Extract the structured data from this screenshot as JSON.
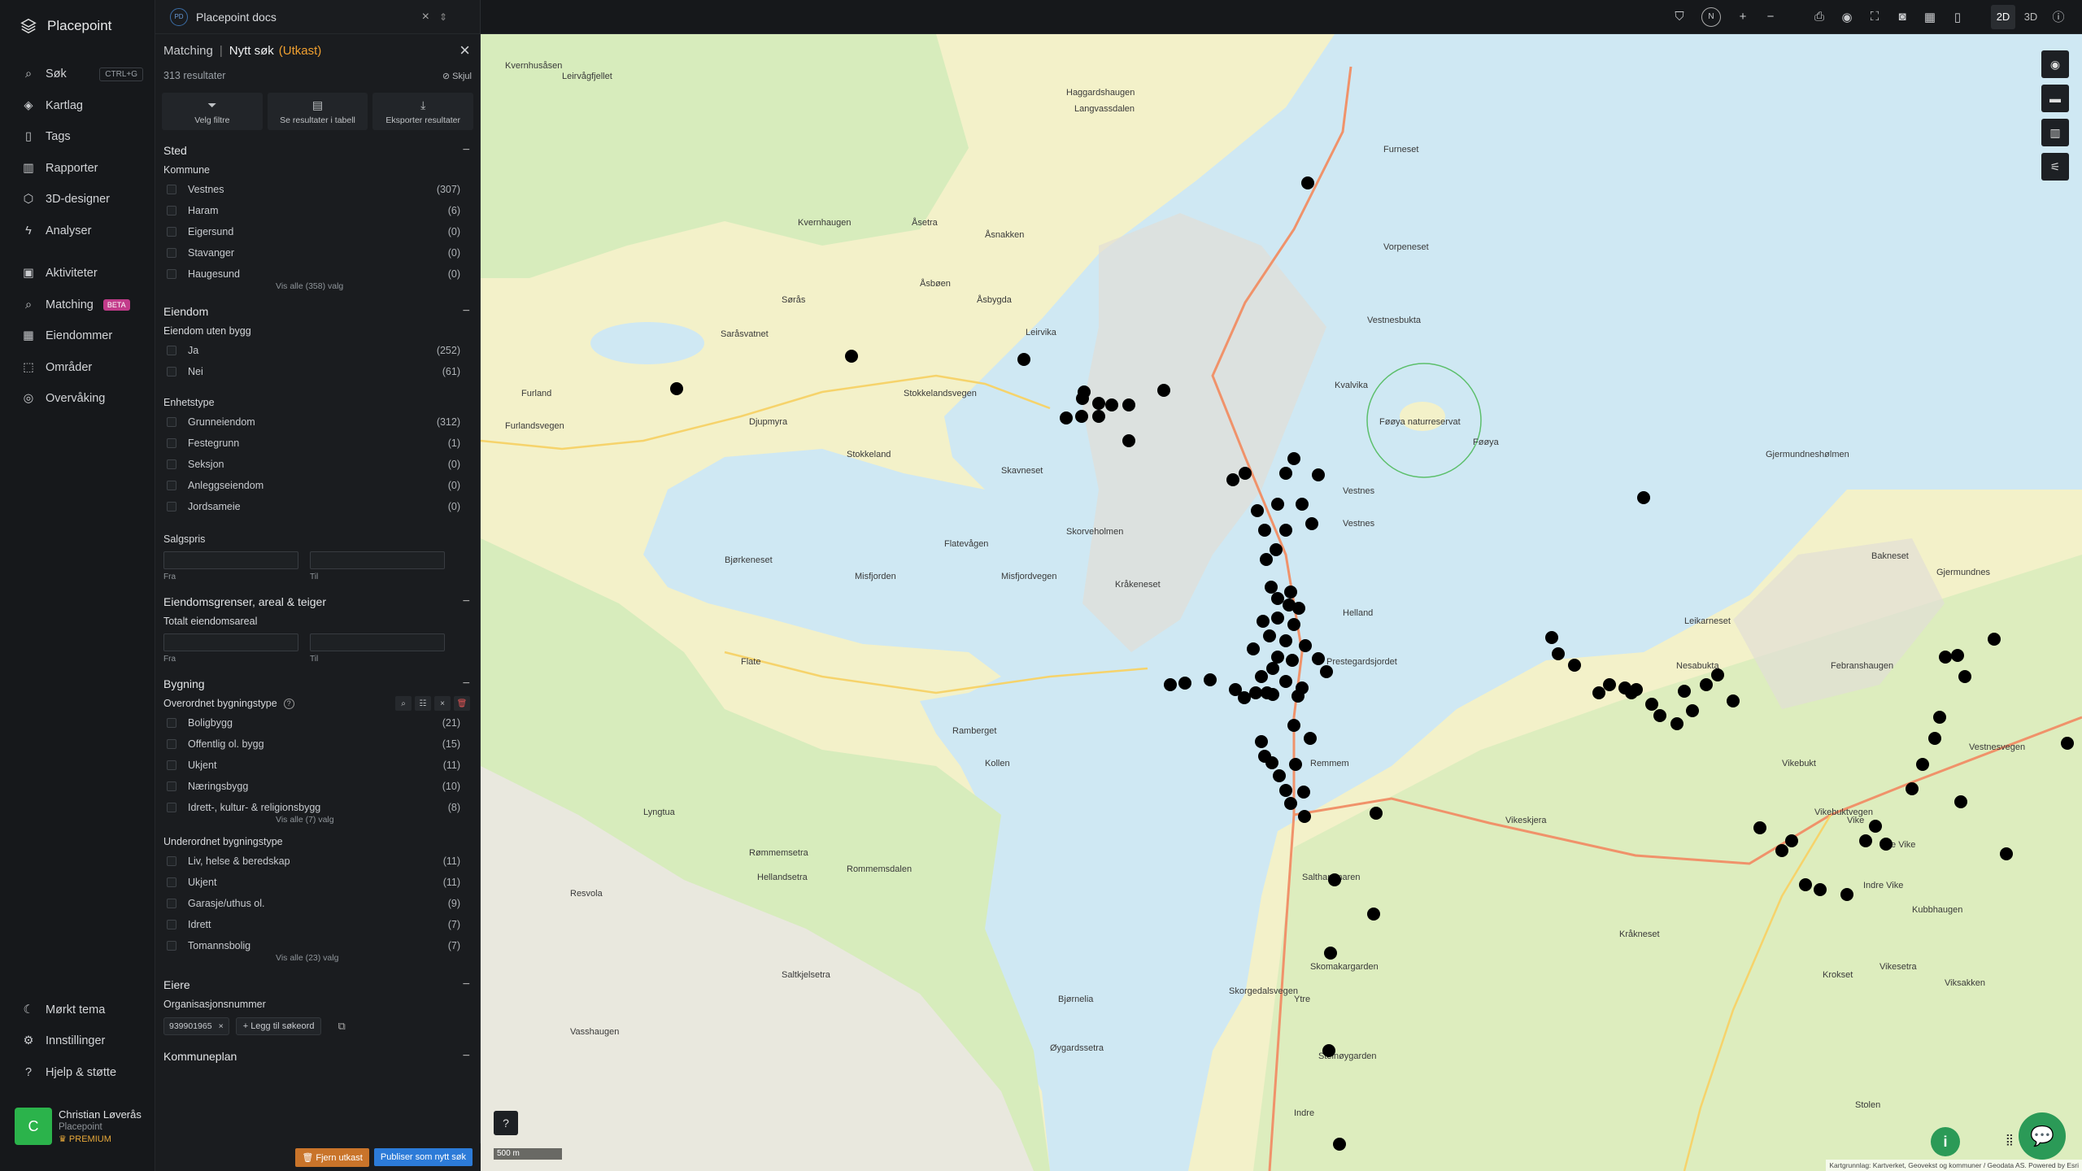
{
  "app": {
    "brand": "Placepoint",
    "project": "Placepoint docs",
    "project_badge": "PD"
  },
  "nav": {
    "items": [
      {
        "label": "Søk",
        "icon": "search-icon",
        "kbd": "CTRL+G"
      },
      {
        "label": "Kartlag",
        "icon": "layers-icon"
      },
      {
        "label": "Tags",
        "icon": "bookmark-icon"
      },
      {
        "label": "Rapporter",
        "icon": "bar-chart-icon"
      },
      {
        "label": "3D-designer",
        "icon": "cube-icon"
      },
      {
        "label": "Analyser",
        "icon": "bolt-icon"
      }
    ],
    "items2": [
      {
        "label": "Aktiviteter",
        "icon": "activity-icon"
      },
      {
        "label": "Matching",
        "icon": "match-search-icon",
        "badge": "BETA"
      },
      {
        "label": "Eiendommer",
        "icon": "building-icon"
      },
      {
        "label": "Områder",
        "icon": "area-icon"
      },
      {
        "label": "Overvåking",
        "icon": "monitor-icon"
      }
    ],
    "bottom": [
      {
        "label": "Mørkt tema",
        "icon": "moon-icon"
      },
      {
        "label": "Innstillinger",
        "icon": "gear-icon"
      },
      {
        "label": "Hjelp & støtte",
        "icon": "help-icon"
      }
    ],
    "user": {
      "initial": "C",
      "name": "Christian Løverås",
      "org": "Placepoint",
      "plan": "PREMIUM"
    }
  },
  "panel": {
    "crumb": "Matching",
    "sep": "|",
    "title": "Nytt søk",
    "status": "(Utkast)",
    "results": "313 resultater",
    "hide": "Skjul",
    "actions": [
      {
        "label": "Velg filtre",
        "icon": "filter-icon"
      },
      {
        "label": "Se resultater i tabell",
        "icon": "table-icon"
      },
      {
        "label": "Eksporter resultater",
        "icon": "download-icon"
      }
    ],
    "sted": {
      "title": "Sted",
      "kommune_label": "Kommune",
      "kommune": [
        {
          "name": "Vestnes",
          "count": "(307)"
        },
        {
          "name": "Haram",
          "count": "(6)"
        },
        {
          "name": "Eigersund",
          "count": "(0)"
        },
        {
          "name": "Stavanger",
          "count": "(0)"
        },
        {
          "name": "Haugesund",
          "count": "(0)"
        }
      ],
      "see_all": "Vis alle (358) valg"
    },
    "eiendom": {
      "title": "Eiendom",
      "uten_bygg_label": "Eiendom uten bygg",
      "uten_bygg": [
        {
          "name": "Ja",
          "count": "(252)"
        },
        {
          "name": "Nei",
          "count": "(61)"
        }
      ],
      "enhetstype_label": "Enhetstype",
      "enhetstype": [
        {
          "name": "Grunneiendom",
          "count": "(312)"
        },
        {
          "name": "Festegrunn",
          "count": "(1)"
        },
        {
          "name": "Seksjon",
          "count": "(0)"
        },
        {
          "name": "Anleggseiendom",
          "count": "(0)"
        },
        {
          "name": "Jordsameie",
          "count": "(0)"
        }
      ],
      "salgspris_label": "Salgspris",
      "from": "Fra",
      "to": "Til"
    },
    "grenser": {
      "title": "Eiendomsgrenser, areal & teiger",
      "areal_label": "Totalt eiendomsareal",
      "from": "Fra",
      "to": "Til"
    },
    "bygning": {
      "title": "Bygning",
      "overordnet_label": "Overordnet bygningstype",
      "overordnet": [
        {
          "name": "Boligbygg",
          "count": "(21)"
        },
        {
          "name": "Offentlig ol. bygg",
          "count": "(15)"
        },
        {
          "name": "Ukjent",
          "count": "(11)"
        },
        {
          "name": "Næringsbygg",
          "count": "(10)"
        },
        {
          "name": "Idrett-, kultur- & religionsbygg",
          "count": "(8)"
        }
      ],
      "overordnet_see_all": "Vis alle (7) valg",
      "underordnet_label": "Underordnet bygningstype",
      "underordnet": [
        {
          "name": "Liv, helse & beredskap",
          "count": "(11)"
        },
        {
          "name": "Ukjent",
          "count": "(11)"
        },
        {
          "name": "Garasje/uthus ol.",
          "count": "(9)"
        },
        {
          "name": "Idrett",
          "count": "(7)"
        },
        {
          "name": "Tomannsbolig",
          "count": "(7)"
        }
      ],
      "underordnet_see_all": "Vis alle (23) valg"
    },
    "eiere": {
      "title": "Eiere",
      "org_label": "Organisasjonsnummer",
      "chip": "939901965",
      "add": "Legg til søkeord"
    },
    "kommuneplan": {
      "title": "Kommuneplan"
    },
    "footer": {
      "remove": "Fjern utkast",
      "publish": "Publiser som nytt søk"
    }
  },
  "topbar": {
    "north": "N",
    "mode_2d": "2D",
    "mode_3d": "3D"
  },
  "map": {
    "scale": "500 m",
    "attribution": "Kartgrunnlag: Kartverket, Geovekst og kommuner / Geodata AS. Powered by Esri",
    "water_color": "#cfe8f3",
    "land_color": "#f3f1c9",
    "place_labels": [
      "Furneset",
      "Vorpeneset",
      "Vestnesbukta",
      "Kvalvika",
      "Kvernhusåsen",
      "Leirvågfjellet",
      "Haggardshaugen",
      "Langvassdalen",
      "Kvernhaugen",
      "Åsetra",
      "Åsnakken",
      "Åsbøen",
      "Sørås",
      "Åsbygda",
      "Leirvika",
      "Saråsvatnet",
      "Furland",
      "Furlandsvegen",
      "Stokkelandsvegen",
      "Djupmyra",
      "Stokkeland",
      "Skavneset",
      "Flatevågen",
      "Skorveholmen",
      "Bjørkeneset",
      "Misfjorden",
      "Misfjordvegen",
      "Kråkeneset",
      "Vestnes",
      "Helland",
      "Prestegardsjordet",
      "Flate",
      "Ramberget",
      "Kollen",
      "Remmem",
      "Lyngtua",
      "Rømmemsetra",
      "Hellandsetra",
      "Salthammaren",
      "Skorgedalsvegen",
      "Skomakargarden",
      "Ytre",
      "Steinøygarden",
      "Indre",
      "Øygardssetra",
      "Bjørnelia",
      "Saltkjelsetra",
      "Vasshaugen",
      "Resvola",
      "Rommemsdalen",
      "Leikarneset",
      "Nesabukta",
      "Febranshaugen",
      "Vestnesvegen",
      "Vikebukt",
      "Vikebuktvegen",
      "Vike",
      "Ytre Vike",
      "Indre Vike",
      "Krokset",
      "Vikesetra",
      "Viksakken",
      "Kubbhaugen",
      "Kråkneset",
      "Gjermundnes",
      "Bakneset",
      "Gjermundneshølmen",
      "Føøya",
      "Føøya naturreservat",
      "Vikeskjera",
      "Stolen",
      "Vestnes"
    ],
    "marker_color": "#000000"
  }
}
